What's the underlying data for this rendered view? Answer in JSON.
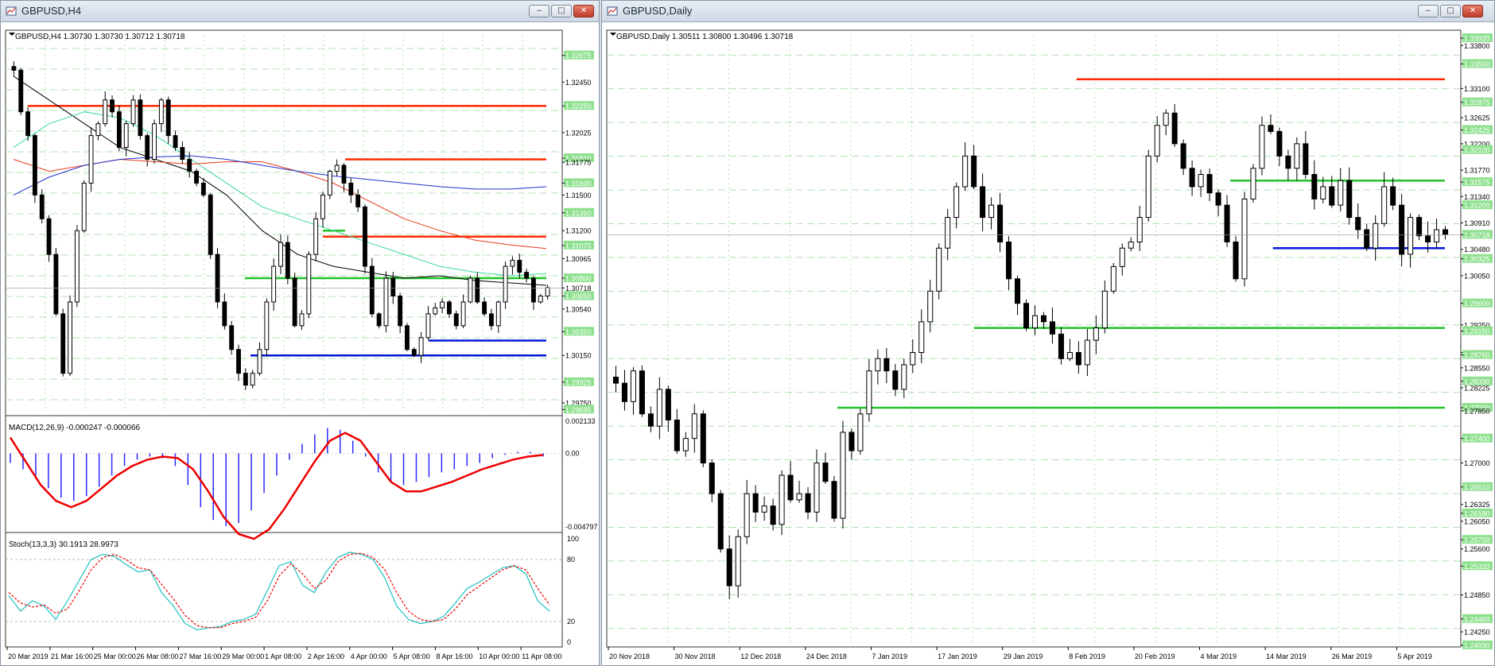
{
  "colors": {
    "bull": "#ffffff",
    "bear": "#000000",
    "grid": "#b3e0b3",
    "resistance": "#ff2a00",
    "support_green": "#22c32a",
    "support_blue": "#0016d6",
    "macd_hist": "#2a2aff",
    "macd_signal": "#ee0000",
    "stoch_main": "#20c0c0",
    "stoch_signal": "#ee0000",
    "ma_black": "#000000",
    "ma_teal": "#3ad9a0",
    "ma_red": "#e83a1a",
    "ma_blue": "#2030d0"
  },
  "left_window": {
    "title": "GBPUSD,H4",
    "header": "GBPUSD,H4  1.30730 1.30730 1.30712 1.30718",
    "macd_label": "MACD(12,26,9) -0.000247 -0.000066",
    "stoch_label": "Stoch(13,3,3) 30.1913 28.9973",
    "price_scale": [
      "1.32675",
      "1.32450",
      "1.32250",
      "1.32025",
      "1.31810",
      "1.31775",
      "1.31600",
      "1.31500",
      "1.31350",
      "1.31200",
      "1.31075",
      "1.30965",
      "1.30800",
      "1.30718",
      "1.30650",
      "1.30540",
      "1.30350",
      "1.30150",
      "1.29925",
      "1.29750",
      "1.29695"
    ],
    "macd_scale": [
      "0.002133",
      "0.00",
      "-0.004797"
    ],
    "stoch_scale": [
      "100",
      "80",
      "20",
      "0"
    ],
    "time_labels": [
      "20 Mar 2019",
      "21 Mar 16:00",
      "25 Mar 00:00",
      "26 Mar 08:00",
      "27 Mar 16:00",
      "29 Mar 00:00",
      "1 Apr 08:00",
      "2 Apr 16:00",
      "4 Apr 00:00",
      "5 Apr 08:00",
      "8 Apr 16:00",
      "10 Apr 00:00",
      "11 Apr 08:00"
    ]
  },
  "right_window": {
    "title": "GBPUSD,Daily",
    "header": "GBPUSD,Daily  1.30511 1.30800 1.30496 1.30718",
    "price_scale": [
      "1.33920",
      "1.33800",
      "1.33500",
      "1.33100",
      "1.32875",
      "1.32625",
      "1.32425",
      "1.32200",
      "1.32100",
      "1.31770",
      "1.31575",
      "1.31340",
      "1.31200",
      "1.30910",
      "1.30718",
      "1.30480",
      "1.30325",
      "1.30050",
      "1.29600",
      "1.29250",
      "1.29150",
      "1.28800",
      "1.28760",
      "1.28550",
      "1.28330",
      "1.28225",
      "1.27900",
      "1.27850",
      "1.27400",
      "1.27000",
      "1.26610",
      "1.26325",
      "1.26180",
      "1.26050",
      "1.25750",
      "1.25600",
      "1.25320",
      "1.24850",
      "1.24460",
      "1.24250",
      "1.24030"
    ],
    "time_labels": [
      "20 Nov 2018",
      "30 Nov 2018",
      "12 Dec 2018",
      "24 Dec 2018",
      "7 Jan 2019",
      "17 Jan 2019",
      "29 Jan 2019",
      "8 Feb 2019",
      "20 Feb 2019",
      "4 Mar 2019",
      "14 Mar 2019",
      "26 Mar 2019",
      "5 Apr 2019"
    ]
  },
  "chart_data": [
    {
      "type": "candlestick",
      "symbol": "GBPUSD",
      "timeframe": "H4",
      "ylim": [
        1.2969,
        1.3282
      ],
      "last_price": 1.30718,
      "ohlc_close_path_approx": [
        1.3255,
        1.322,
        1.32,
        1.315,
        1.313,
        1.31,
        1.305,
        1.3,
        1.306,
        1.312,
        1.316,
        1.32,
        1.321,
        1.323,
        1.322,
        1.319,
        1.321,
        1.323,
        1.32,
        1.318,
        1.321,
        1.323,
        1.32,
        1.319,
        1.318,
        1.317,
        1.316,
        1.315,
        1.31,
        1.306,
        1.304,
        1.302,
        1.3,
        1.299,
        1.3,
        1.302,
        1.306,
        1.309,
        1.311,
        1.308,
        1.304,
        1.305,
        1.31,
        1.313,
        1.315,
        1.317,
        1.3175,
        1.316,
        1.315,
        1.314,
        1.309,
        1.305,
        1.304,
        1.308,
        1.3065,
        1.304,
        1.302,
        1.3015,
        1.303,
        1.305,
        1.3055,
        1.306,
        1.305,
        1.304,
        1.306,
        1.308,
        1.306,
        1.305,
        1.304,
        1.306,
        1.309,
        1.3095,
        1.3085,
        1.308,
        1.306,
        1.3065,
        1.3072
      ],
      "horizontal_levels": [
        {
          "price": 1.3225,
          "color": "resistance",
          "from": 0.04
        },
        {
          "price": 1.318,
          "color": "resistance",
          "from": 0.61
        },
        {
          "price": 1.3115,
          "color": "resistance",
          "from": 0.57
        },
        {
          "price": 1.312,
          "color": "support_green",
          "from": 0.57,
          "to": 0.61
        },
        {
          "price": 1.308,
          "color": "support_green",
          "from": 0.43
        },
        {
          "price": 1.30275,
          "color": "support_blue",
          "from": 0.76
        },
        {
          "price": 1.3015,
          "color": "support_blue",
          "from": 0.44
        }
      ],
      "moving_averages": {
        "black": [
          1.325,
          1.323,
          1.321,
          1.319,
          1.318,
          1.317,
          1.315,
          1.312,
          1.31,
          1.309,
          1.3085,
          1.308,
          1.3082,
          1.3078,
          1.3076,
          1.3074
        ],
        "teal": [
          1.319,
          1.321,
          1.322,
          1.3215,
          1.32,
          1.318,
          1.316,
          1.314,
          1.313,
          1.312,
          1.311,
          1.31,
          1.309,
          1.3085,
          1.3082,
          1.3084
        ],
        "red": [
          1.318,
          1.317,
          1.3175,
          1.318,
          1.3178,
          1.3176,
          1.3178,
          1.3178,
          1.317,
          1.316,
          1.3145,
          1.313,
          1.312,
          1.3112,
          1.3108,
          1.3105
        ],
        "blue": [
          1.315,
          1.3165,
          1.3175,
          1.318,
          1.3182,
          1.3183,
          1.318,
          1.3175,
          1.317,
          1.3166,
          1.3163,
          1.316,
          1.3157,
          1.3155,
          1.3155,
          1.3157
        ]
      },
      "macd": {
        "ylim": [
          -0.004797,
          0.002133
        ],
        "histogram": [
          -0.0006,
          -0.001,
          -0.0016,
          -0.0022,
          -0.0028,
          -0.003,
          -0.0027,
          -0.0021,
          -0.0014,
          -0.0008,
          -0.0004,
          -0.0002,
          -0.0003,
          -0.0008,
          -0.002,
          -0.0034,
          -0.0042,
          -0.0046,
          -0.0044,
          -0.0036,
          -0.0025,
          -0.0014,
          -0.0004,
          0.0006,
          0.0012,
          0.0016,
          0.0015,
          0.0008,
          -0.0002,
          -0.0012,
          -0.0018,
          -0.002,
          -0.0018,
          -0.0015,
          -0.0012,
          -0.001,
          -0.0008,
          -0.0006,
          -0.0003,
          -0.0001,
          0.0001,
          0.0001,
          -0.0002
        ],
        "signal": [
          0.001,
          -0.0005,
          -0.002,
          -0.003,
          -0.0034,
          -0.003,
          -0.0022,
          -0.0014,
          -0.0008,
          -0.0004,
          -0.0002,
          -0.0003,
          -0.001,
          -0.0024,
          -0.004,
          -0.0051,
          -0.0054,
          -0.0048,
          -0.0035,
          -0.002,
          -0.0005,
          0.0008,
          0.0013,
          0.0008,
          -0.0005,
          -0.0018,
          -0.0024,
          -0.0024,
          -0.0021,
          -0.0018,
          -0.0014,
          -0.001,
          -0.0007,
          -0.0004,
          -0.0002,
          -0.0001
        ]
      },
      "stochastic": {
        "ylim": [
          0,
          100
        ],
        "levels": [
          80,
          20
        ],
        "main": [
          45,
          30,
          40,
          35,
          22,
          40,
          60,
          80,
          85,
          83,
          75,
          68,
          70,
          48,
          35,
          18,
          12,
          14,
          15,
          20,
          22,
          27,
          50,
          74,
          78,
          55,
          48,
          68,
          82,
          87,
          85,
          80,
          62,
          35,
          22,
          18,
          20,
          25,
          38,
          52,
          58,
          65,
          72,
          74,
          66,
          40,
          30
        ],
        "signal": [
          48,
          38,
          34,
          36,
          28,
          32,
          50,
          70,
          82,
          85,
          80,
          72,
          70,
          56,
          42,
          26,
          16,
          14,
          14,
          18,
          20,
          24,
          40,
          64,
          76,
          66,
          52,
          60,
          78,
          85,
          86,
          82,
          70,
          48,
          30,
          22,
          20,
          22,
          32,
          46,
          54,
          62,
          70,
          74,
          70,
          52,
          36
        ]
      }
    },
    {
      "type": "candlestick",
      "symbol": "GBPUSD",
      "timeframe": "Daily",
      "ylim": [
        1.2403,
        1.3392
      ],
      "last_price": 1.30718,
      "ohlc_close_path_approx": [
        1.283,
        1.28,
        1.285,
        1.278,
        1.276,
        1.282,
        1.277,
        1.272,
        1.274,
        1.278,
        1.27,
        1.265,
        1.256,
        1.25,
        1.258,
        1.265,
        1.262,
        1.263,
        1.26,
        1.268,
        1.264,
        1.265,
        1.262,
        1.27,
        1.267,
        1.261,
        1.275,
        1.272,
        1.278,
        1.285,
        1.287,
        1.285,
        1.282,
        1.286,
        1.288,
        1.293,
        1.298,
        1.305,
        1.31,
        1.315,
        1.32,
        1.315,
        1.31,
        1.312,
        1.306,
        1.3,
        1.296,
        1.292,
        1.294,
        1.293,
        1.291,
        1.287,
        1.288,
        1.286,
        1.29,
        1.292,
        1.298,
        1.302,
        1.305,
        1.306,
        1.31,
        1.32,
        1.325,
        1.327,
        1.322,
        1.318,
        1.315,
        1.317,
        1.314,
        1.312,
        1.306,
        1.3,
        1.313,
        1.318,
        1.325,
        1.324,
        1.32,
        1.318,
        1.322,
        1.317,
        1.313,
        1.315,
        1.312,
        1.316,
        1.31,
        1.308,
        1.305,
        1.309,
        1.315,
        1.312,
        1.304,
        1.31,
        1.307,
        1.306,
        1.308,
        1.3072
      ],
      "horizontal_levels": [
        {
          "price": 1.3325,
          "color": "resistance",
          "from": 0.55
        },
        {
          "price": 1.316,
          "color": "support_green",
          "from": 0.73
        },
        {
          "price": 1.305,
          "color": "support_blue",
          "from": 0.78
        },
        {
          "price": 1.292,
          "color": "support_green",
          "from": 0.43
        },
        {
          "price": 1.279,
          "color": "support_green",
          "from": 0.27
        }
      ]
    }
  ]
}
